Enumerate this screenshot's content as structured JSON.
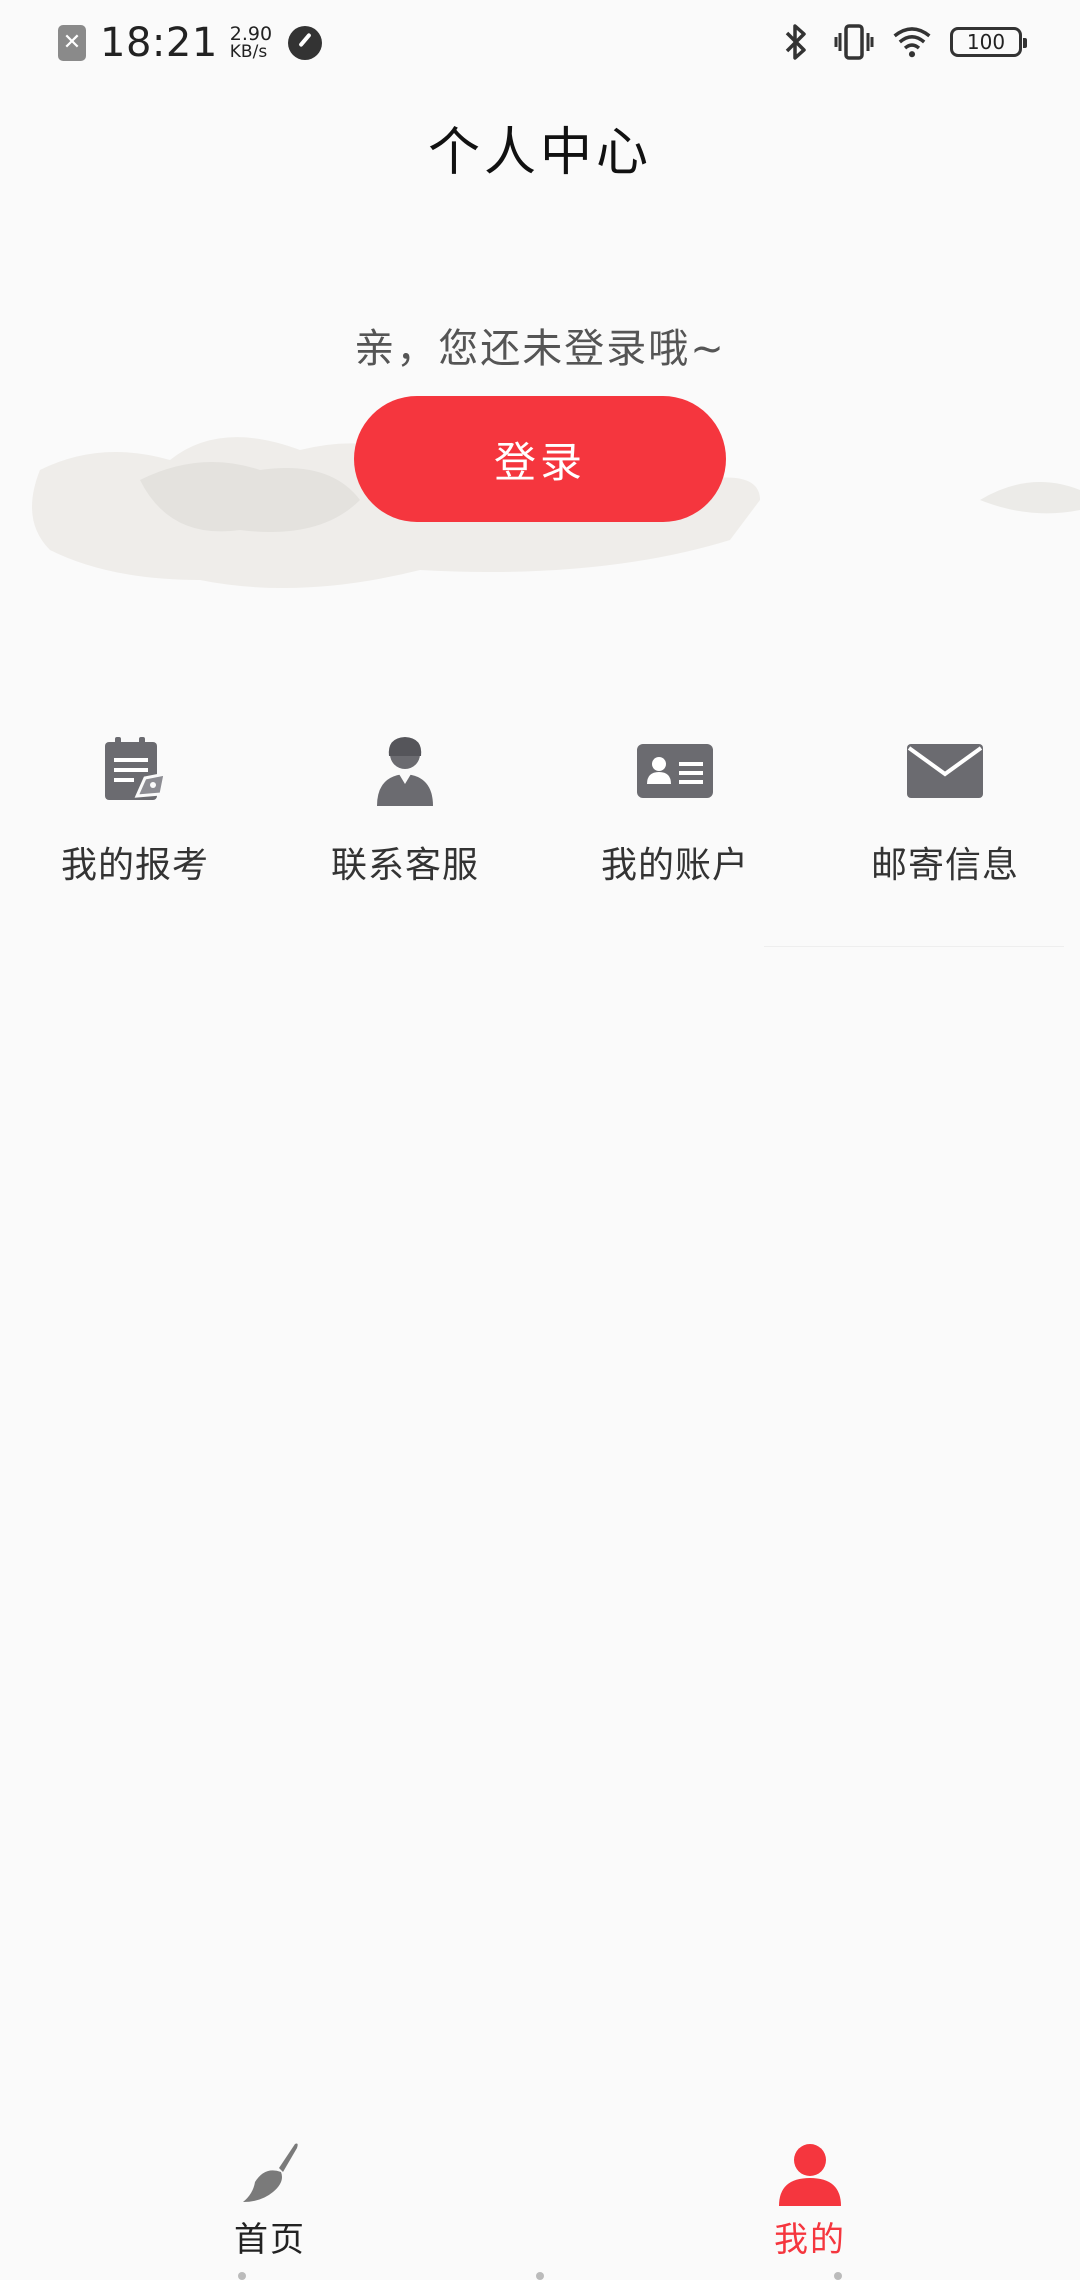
{
  "status_bar": {
    "time": "18:21",
    "speed_value": "2.90",
    "speed_unit": "KB/s",
    "battery": "100"
  },
  "header": {
    "title": "个人中心"
  },
  "login": {
    "hint": "亲，您还未登录哦~",
    "button_label": "登录"
  },
  "menu": {
    "items": [
      {
        "label": "我的报考",
        "icon": "exam-registration-icon"
      },
      {
        "label": "联系客服",
        "icon": "customer-service-icon"
      },
      {
        "label": "我的账户",
        "icon": "account-card-icon"
      },
      {
        "label": "邮寄信息",
        "icon": "mail-envelope-icon"
      }
    ]
  },
  "tabbar": {
    "tabs": [
      {
        "label": "首页",
        "icon": "brush-icon",
        "active": false
      },
      {
        "label": "我的",
        "icon": "person-icon",
        "active": true
      }
    ]
  },
  "colors": {
    "accent": "#f5363e",
    "icon_gray": "#666666",
    "background": "#fafafa"
  }
}
